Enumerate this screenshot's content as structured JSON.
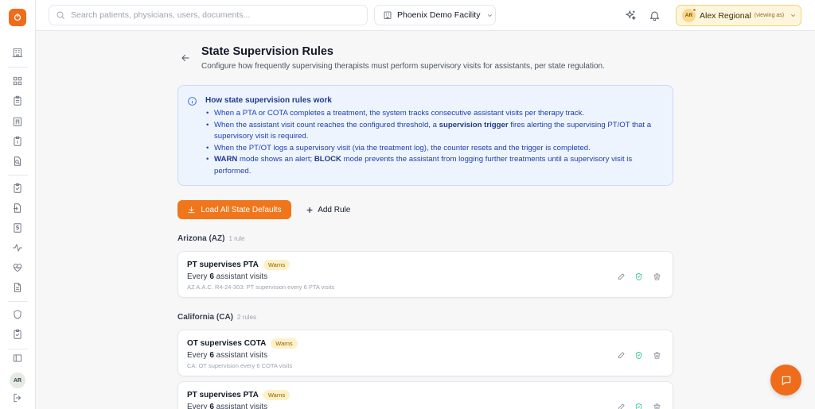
{
  "brand": {
    "accent": "#ef6c1a",
    "logo_icon": "brand-logo-icon"
  },
  "sidebar": {
    "items": [
      {
        "name": "sidebar-item-facility",
        "icon": "building-icon"
      },
      {
        "name": "sidebar-item-dashboard",
        "icon": "grid-icon"
      },
      {
        "name": "sidebar-item-clipboard",
        "icon": "clipboard-icon"
      },
      {
        "name": "sidebar-item-calendar",
        "icon": "calendar-icon"
      },
      {
        "name": "sidebar-item-tasks",
        "icon": "clipboard-list-icon"
      },
      {
        "name": "sidebar-item-reports",
        "icon": "file-search-icon"
      },
      {
        "name": "sidebar-item-checks",
        "icon": "clipboard-check-icon"
      },
      {
        "name": "sidebar-item-import",
        "icon": "file-import-icon"
      },
      {
        "name": "sidebar-item-billing",
        "icon": "dollar-file-icon"
      },
      {
        "name": "sidebar-item-activity",
        "icon": "activity-icon"
      },
      {
        "name": "sidebar-item-health",
        "icon": "heart-pulse-icon"
      },
      {
        "name": "sidebar-item-documents",
        "icon": "document-icon"
      },
      {
        "name": "sidebar-item-security",
        "icon": "shield-icon"
      },
      {
        "name": "sidebar-item-compliance",
        "icon": "clipboard-check-icon"
      },
      {
        "name": "sidebar-collapse",
        "icon": "panel-left-icon"
      },
      {
        "name": "sidebar-logout",
        "icon": "logout-icon"
      }
    ],
    "avatar_initials": "AR"
  },
  "topbar": {
    "search_placeholder": "Search patients, physicians, users, documents...",
    "facility": "Phoenix Demo Facility",
    "user": {
      "initials": "AR",
      "name": "Alex Regional",
      "sub": "(viewing as)"
    }
  },
  "page": {
    "title": "State Supervision Rules",
    "subtitle": "Configure how frequently supervising therapists must perform supervisory visits for assistants, per state regulation."
  },
  "info": {
    "title": "How state supervision rules work",
    "items": [
      {
        "pre": "When a PTA or COTA completes a treatment, the system tracks consecutive assistant visits per therapy track.",
        "bold": "",
        "post": ""
      },
      {
        "pre": "When the assistant visit count reaches the configured threshold, a ",
        "bold": "supervision trigger",
        "post": " fires alerting the supervising PT/OT that a supervisory visit is required."
      },
      {
        "pre": "When the PT/OT logs a supervisory visit (via the treatment log), the counter resets and the trigger is completed.",
        "bold": "",
        "post": ""
      },
      {
        "pre": "",
        "bold": "WARN",
        "post": " mode shows an alert; ",
        "bold2": "BLOCK",
        "post2": " mode prevents the assistant from logging further treatments until a supervisory visit is performed."
      }
    ]
  },
  "actions": {
    "load_defaults": "Load All State Defaults",
    "add_rule": "Add Rule"
  },
  "groups": [
    {
      "state": "Arizona (AZ)",
      "count": "1 rule",
      "rules": [
        {
          "title": "PT supervises PTA",
          "badge": "Warns",
          "freq_pre": "Every ",
          "freq_num": "6",
          "freq_post": " assistant visits",
          "cite": "AZ A.A.C. R4-24-303: PT supervision every 6 PTA visits"
        }
      ]
    },
    {
      "state": "California (CA)",
      "count": "2 rules",
      "rules": [
        {
          "title": "OT supervises COTA",
          "badge": "Warns",
          "freq_pre": "Every ",
          "freq_num": "6",
          "freq_post": " assistant visits",
          "cite": "CA: OT supervision every 6 COTA visits"
        },
        {
          "title": "PT supervises PTA",
          "badge": "Warns",
          "freq_pre": "Every ",
          "freq_num": "6",
          "freq_post": " assistant visits",
          "cite": ""
        }
      ]
    }
  ],
  "chat_icon": "chat-bubble-icon"
}
